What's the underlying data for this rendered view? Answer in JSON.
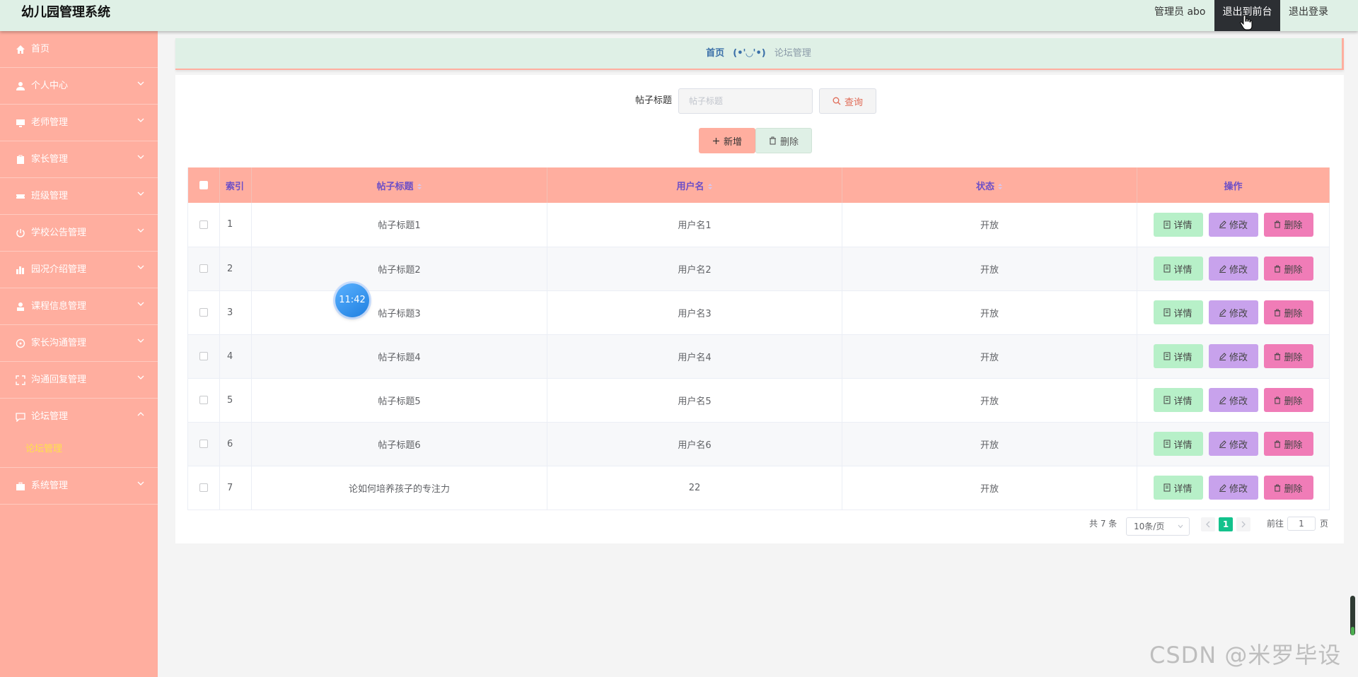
{
  "header": {
    "title": "幼儿园管理系统",
    "admin_label": "管理员 abo",
    "front_button": "退出到前台",
    "logout_button": "退出登录"
  },
  "sidebar": {
    "items": [
      {
        "label": "首页",
        "icon": "home-icon"
      },
      {
        "label": "个人中心",
        "icon": "user-icon"
      },
      {
        "label": "老师管理",
        "icon": "monitor-icon"
      },
      {
        "label": "家长管理",
        "icon": "clipboard-icon"
      },
      {
        "label": "班级管理",
        "icon": "ticket-icon"
      },
      {
        "label": "学校公告管理",
        "icon": "power-icon"
      },
      {
        "label": "园况介绍管理",
        "icon": "chart-icon"
      },
      {
        "label": "课程信息管理",
        "icon": "person-icon"
      },
      {
        "label": "家长沟通管理",
        "icon": "compass-icon"
      },
      {
        "label": "沟通回复管理",
        "icon": "fullscreen-icon"
      },
      {
        "label": "论坛管理",
        "icon": "chat-icon"
      }
    ],
    "sub_item": "论坛管理",
    "last_item": {
      "label": "系统管理",
      "icon": "briefcase-icon"
    }
  },
  "breadcrumb": {
    "home": "首页",
    "separator": "(•'◡'•)",
    "current": "论坛管理"
  },
  "search": {
    "label": "帖子标题",
    "placeholder": "帖子标题",
    "query_button": "查询"
  },
  "toolbar": {
    "add_button": "新增",
    "delete_button": "删除"
  },
  "table": {
    "columns": [
      "索引",
      "帖子标题",
      "用户名",
      "状态",
      "操作"
    ],
    "rows": [
      {
        "index": "1",
        "title": "帖子标题1",
        "username": "用户名1",
        "status": "开放"
      },
      {
        "index": "2",
        "title": "帖子标题2",
        "username": "用户名2",
        "status": "开放"
      },
      {
        "index": "3",
        "title": "帖子标题3",
        "username": "用户名3",
        "status": "开放"
      },
      {
        "index": "4",
        "title": "帖子标题4",
        "username": "用户名4",
        "status": "开放"
      },
      {
        "index": "5",
        "title": "帖子标题5",
        "username": "用户名5",
        "status": "开放"
      },
      {
        "index": "6",
        "title": "帖子标题6",
        "username": "用户名6",
        "status": "开放"
      },
      {
        "index": "7",
        "title": "论如何培养孩子的专注力",
        "username": "22",
        "status": "开放"
      }
    ],
    "actions": {
      "detail": "详情",
      "edit": "修改",
      "delete": "删除"
    }
  },
  "pagination": {
    "total": "共 7 条",
    "page_size": "10条/页",
    "current_page": "1",
    "goto_label": "前往",
    "goto_value": "1",
    "page_suffix": "页"
  },
  "clock": {
    "time": "11:42"
  },
  "watermark": "CSDN @米罗毕设",
  "colors": {
    "sidebar": "#ffae9f",
    "header": "#dff0e6",
    "accent_green": "#13c28c",
    "detail": "#b7f0c8",
    "edit": "#c8a2ec",
    "delete": "#f07cb7"
  }
}
